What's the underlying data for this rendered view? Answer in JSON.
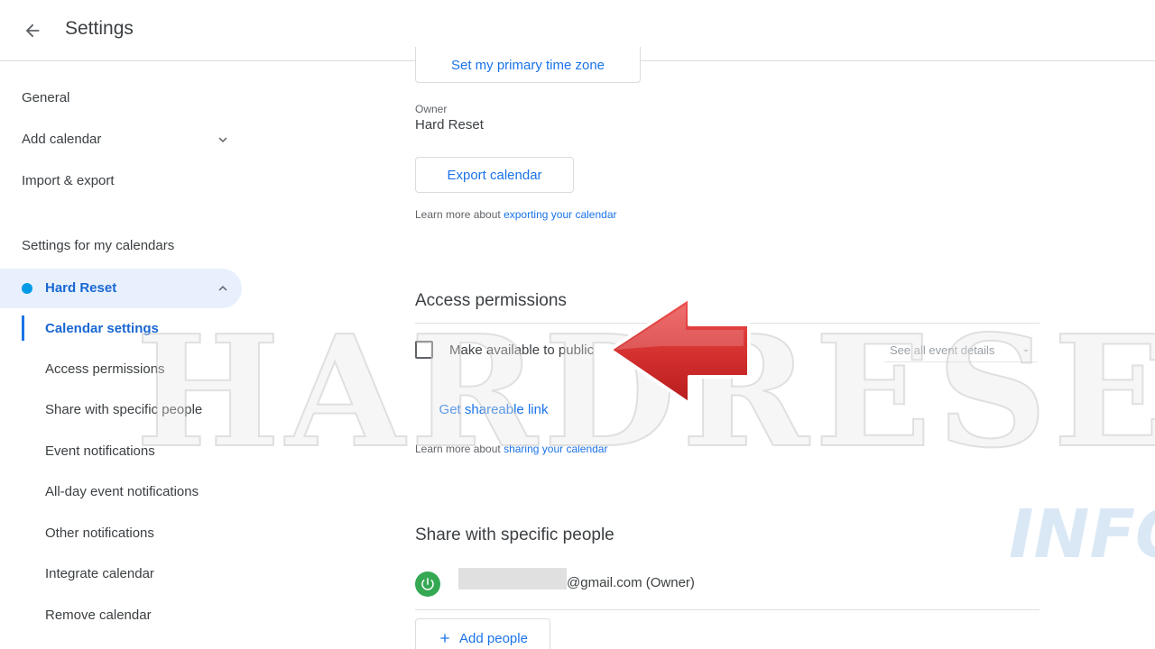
{
  "header": {
    "title": "Settings"
  },
  "sidebar": {
    "items": [
      {
        "label": "General"
      },
      {
        "label": "Add calendar"
      },
      {
        "label": "Import & export"
      }
    ],
    "section_label": "Settings for my calendars",
    "calendar": {
      "name": "Hard Reset",
      "color": "#039be5",
      "sub_items": [
        {
          "label": "Calendar settings",
          "active": true
        },
        {
          "label": "Access permissions"
        },
        {
          "label": "Share with specific people"
        },
        {
          "label": "Event notifications"
        },
        {
          "label": "All-day event notifications"
        },
        {
          "label": "Other notifications"
        },
        {
          "label": "Integrate calendar"
        },
        {
          "label": "Remove calendar"
        }
      ]
    }
  },
  "main": {
    "timezone_button": "Set my primary time zone",
    "owner_label": "Owner",
    "owner_value": "Hard Reset",
    "export_button": "Export calendar",
    "export_help_prefix": "Learn more about",
    "export_help_link": "exporting your calendar",
    "access": {
      "title": "Access permissions",
      "public_checkbox_label": "Make available to public",
      "public_checked": false,
      "detail_select": "See all event details",
      "shareable_link_button": "Get shareable link",
      "help_prefix": "Learn more about",
      "help_link": "sharing your calendar"
    },
    "share": {
      "title": "Share with specific people",
      "person_email_suffix": "@gmail.com (Owner)",
      "add_people_button": "Add people"
    }
  },
  "overlay": {
    "watermark": "HARDRESET",
    "watermark_sub": "INFO",
    "arrow_color": "#d32f2f"
  }
}
